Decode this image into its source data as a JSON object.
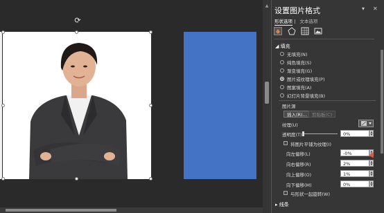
{
  "pane": {
    "title": "设置图片格式",
    "tabs": {
      "shape_options": "形状选项",
      "text_options": "文本选项"
    },
    "icons": [
      "fill-line-icon",
      "effects-icon",
      "size-properties-icon",
      "picture-icon"
    ],
    "fill_section": {
      "header": "填充",
      "options": [
        "无填充(N)",
        "纯色填充(S)",
        "渐变填充(G)",
        "图片或纹理填充(P)",
        "图案填充(A)",
        "幻灯片背景填充(B)"
      ],
      "selected_index": 3
    },
    "picture_source": {
      "header": "图片源",
      "insert_button": "插入(R)...",
      "clipboard_button": "剪贴板(C)"
    },
    "texture_label": "纹理(U)",
    "transparency": {
      "label": "透明度(T)",
      "value": "0%"
    },
    "tile_checkbox": "将图片平铺为纹理(I)",
    "offsets": [
      {
        "label": "向左偏移(L)",
        "value": "-0%"
      },
      {
        "label": "向右偏移(R)",
        "value": "2%"
      },
      {
        "label": "向上偏移(O)",
        "value": "1%"
      },
      {
        "label": "向下偏移(M)",
        "value": "0%"
      }
    ],
    "rotate_checkbox": "与形状一起旋转(W)",
    "line_section": {
      "header": "线条"
    }
  },
  "colors": {
    "accent_rect": "#4472c4",
    "pane_bg": "#363636"
  }
}
